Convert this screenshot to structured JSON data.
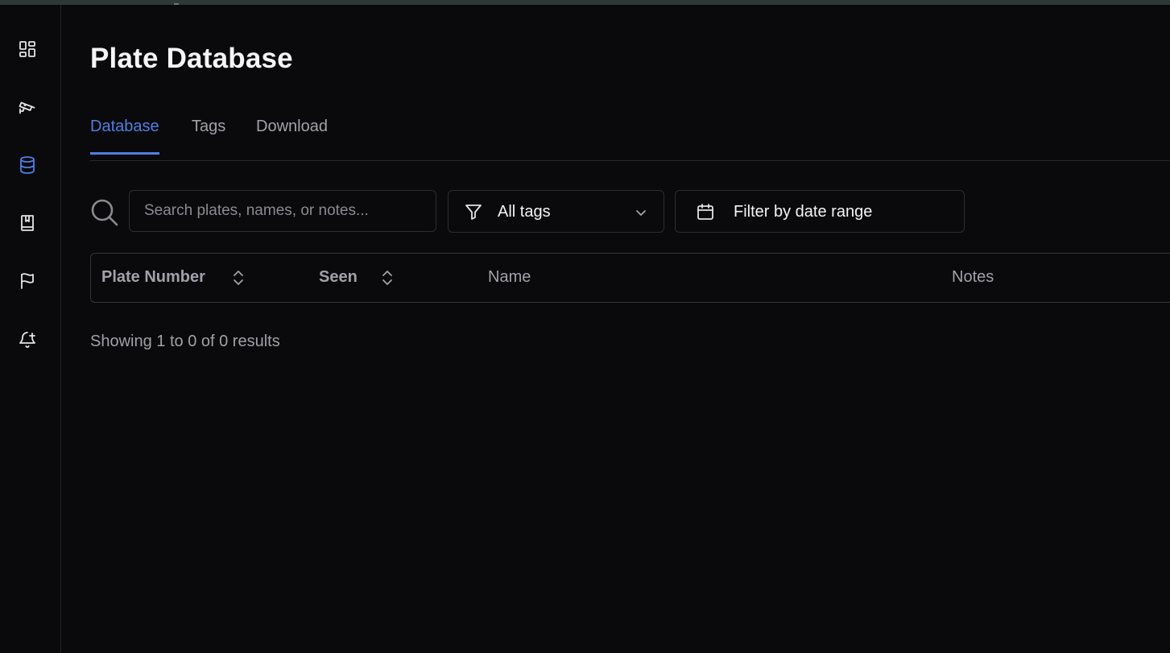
{
  "page": {
    "title": "Plate Database"
  },
  "sidebar": {
    "items": [
      {
        "icon": "dashboard-grid-icon",
        "active": false
      },
      {
        "icon": "security-camera-icon",
        "active": false
      },
      {
        "icon": "database-icon",
        "active": true
      },
      {
        "icon": "bookmark-book-icon",
        "active": false
      },
      {
        "icon": "flag-icon",
        "active": false
      },
      {
        "icon": "bell-plus-icon",
        "active": false
      }
    ]
  },
  "tabs": [
    {
      "label": "Database",
      "active": true
    },
    {
      "label": "Tags",
      "active": false
    },
    {
      "label": "Download",
      "active": false
    }
  ],
  "filters": {
    "search_placeholder": "Search plates, names, or notes...",
    "search_value": "",
    "tag_select_value": "All tags",
    "date_range_label": "Filter by date range"
  },
  "table": {
    "columns": [
      {
        "label": "Plate Number",
        "sortable": true
      },
      {
        "label": "Seen",
        "sortable": true
      },
      {
        "label": "Name",
        "sortable": false
      },
      {
        "label": "Notes",
        "sortable": false
      }
    ],
    "rows": []
  },
  "pagination": {
    "results_text": "Showing 1 to 0 of 0 results"
  },
  "colors": {
    "accent": "#4f7fe3",
    "background": "#0a0a0c",
    "border": "#2c2c33",
    "muted_text": "#a1a1aa",
    "topbar": "#2b3a36"
  }
}
